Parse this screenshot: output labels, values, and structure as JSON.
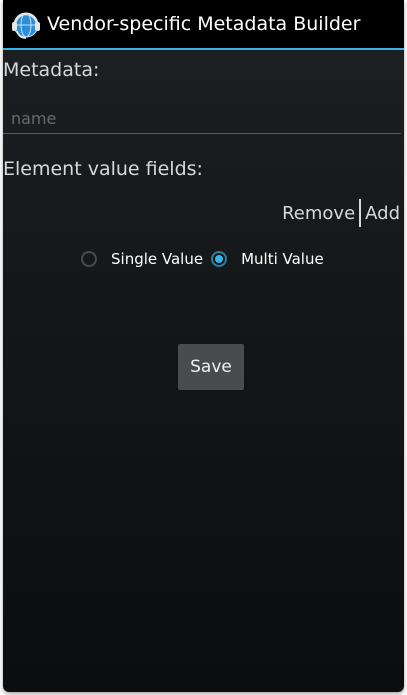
{
  "app": {
    "title": "Vendor-specific Metadata Builder",
    "icon": "headset-globe-icon",
    "accent_color": "#33b5e5"
  },
  "metadata": {
    "label": "Metadata:",
    "name_placeholder": "name",
    "name_value": ""
  },
  "element_fields": {
    "label": "Element value fields:",
    "remove_label": "Remove",
    "add_label": "Add"
  },
  "value_type": {
    "options": [
      {
        "label": "Single Value",
        "checked": false
      },
      {
        "label": "Multi Value",
        "checked": true
      }
    ]
  },
  "actions": {
    "save_label": "Save"
  }
}
